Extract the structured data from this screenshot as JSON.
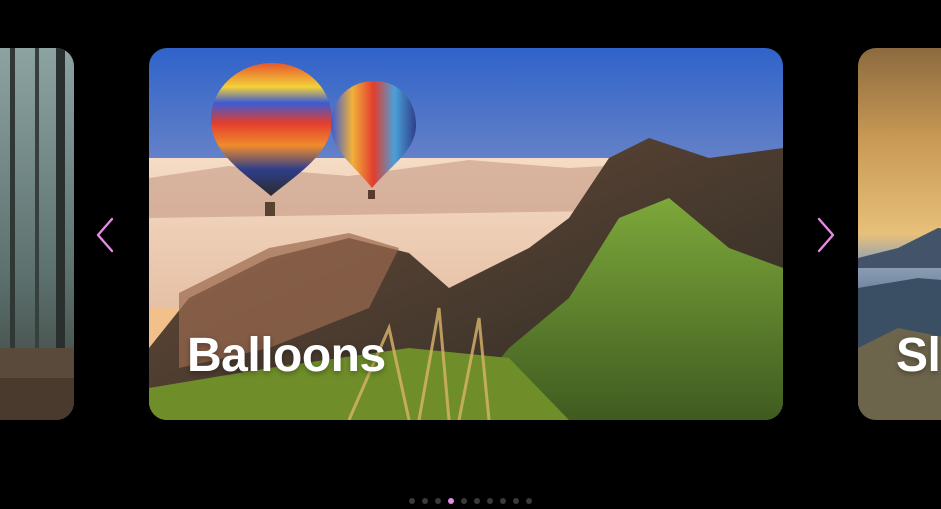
{
  "carousel": {
    "accent_color": "#e58be3",
    "slides": [
      {
        "title": "",
        "scene": "forest"
      },
      {
        "title": "Balloons",
        "scene": "mountain-balloons"
      },
      {
        "title": "Sl",
        "scene": "sunset-lake"
      }
    ],
    "active_index": 3,
    "dot_count": 10,
    "prev_icon": "chevron-left-icon",
    "next_icon": "chevron-right-icon"
  }
}
